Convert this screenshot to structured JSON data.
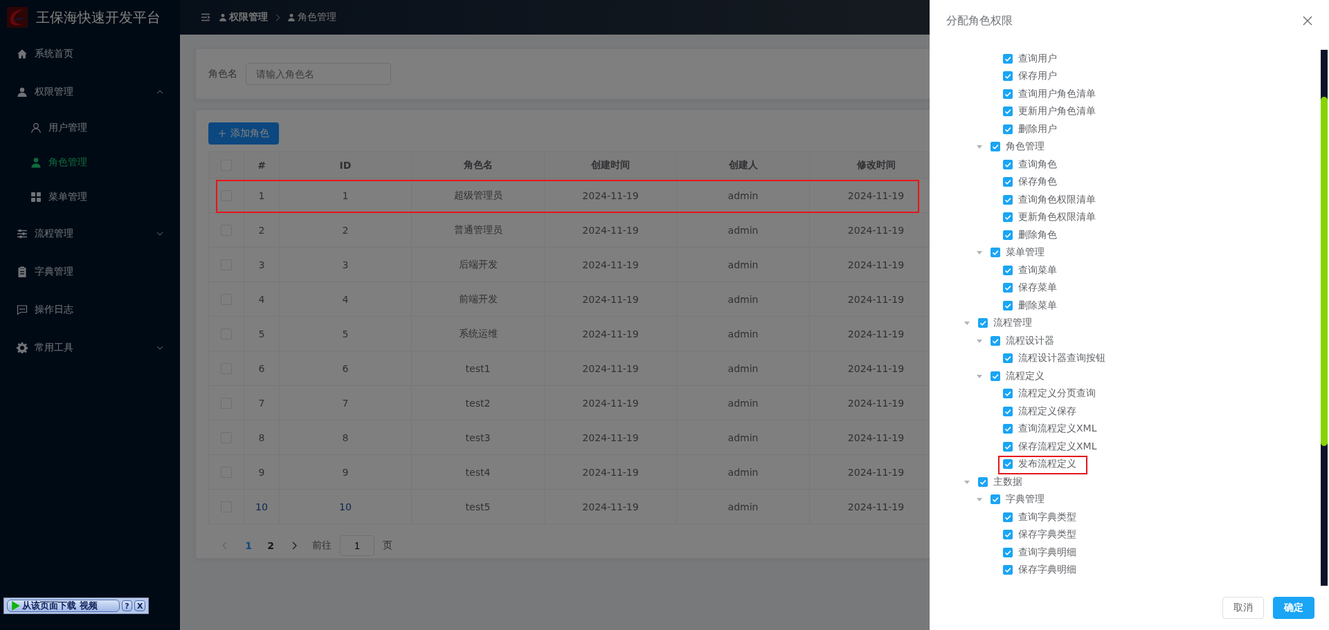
{
  "app": {
    "title": "王保海快速开发平台"
  },
  "breadcrumb": [
    {
      "label": "权限管理"
    },
    {
      "label": "角色管理"
    }
  ],
  "sidebar": {
    "items": [
      {
        "label": "系统首页",
        "selected": false
      },
      {
        "label": "权限管理",
        "selected": false,
        "expanded": true,
        "children": [
          {
            "label": "用户管理",
            "selected": false
          },
          {
            "label": "角色管理",
            "selected": true
          },
          {
            "label": "菜单管理",
            "selected": false
          }
        ]
      },
      {
        "label": "流程管理",
        "selected": false,
        "expanded": false
      },
      {
        "label": "字典管理",
        "selected": false
      },
      {
        "label": "操作日志",
        "selected": false
      },
      {
        "label": "常用工具",
        "selected": false,
        "expanded": false
      }
    ]
  },
  "search": {
    "label": "角色名",
    "placeholder": "请输入角色名"
  },
  "add_button": "添加角色",
  "table": {
    "all_selected": false,
    "columns": [
      "#",
      "ID",
      "角色名",
      "创建时间",
      "创建人",
      "修改时间"
    ],
    "rows": [
      {
        "selected": false,
        "highlighted": true,
        "cells": [
          "1",
          "1",
          "超级管理员",
          "2024-11-19",
          "admin",
          "2024-11-19"
        ]
      },
      {
        "selected": false,
        "highlighted": false,
        "cells": [
          "2",
          "2",
          "普通管理员",
          "2024-11-19",
          "admin",
          "2024-11-19"
        ]
      },
      {
        "selected": false,
        "highlighted": false,
        "cells": [
          "3",
          "3",
          "后端开发",
          "2024-11-19",
          "admin",
          "2024-11-19"
        ]
      },
      {
        "selected": false,
        "highlighted": false,
        "cells": [
          "4",
          "4",
          "前端开发",
          "2024-11-19",
          "admin",
          "2024-11-19"
        ]
      },
      {
        "selected": false,
        "highlighted": false,
        "cells": [
          "5",
          "5",
          "系统运维",
          "2024-11-19",
          "admin",
          "2024-11-19"
        ]
      },
      {
        "selected": false,
        "highlighted": false,
        "cells": [
          "6",
          "6",
          "test1",
          "2024-11-19",
          "admin",
          "2024-11-19"
        ]
      },
      {
        "selected": false,
        "highlighted": false,
        "cells": [
          "7",
          "7",
          "test2",
          "2024-11-19",
          "admin",
          "2024-11-19"
        ]
      },
      {
        "selected": false,
        "highlighted": false,
        "cells": [
          "8",
          "8",
          "test3",
          "2024-11-19",
          "admin",
          "2024-11-19"
        ]
      },
      {
        "selected": false,
        "highlighted": false,
        "cells": [
          "9",
          "9",
          "test4",
          "2024-11-19",
          "admin",
          "2024-11-19"
        ]
      },
      {
        "selected": false,
        "highlighted": false,
        "cells": [
          "10",
          "10",
          "test5",
          "2024-11-19",
          "admin",
          "2024-11-19"
        ]
      }
    ]
  },
  "pagination": {
    "pages": [
      {
        "label": "1",
        "selected": true
      },
      {
        "label": "2",
        "selected": false
      }
    ],
    "goto_label": "前往",
    "goto_value": "1",
    "page_unit": "页"
  },
  "drawer": {
    "title": "分配角色权限",
    "cancel": "取消",
    "confirm": "确定",
    "tree": [
      {
        "children": [
          {
            "children": [
              {
                "label": "查询用户",
                "checked": true,
                "highlighted": false
              },
              {
                "label": "保存用户",
                "checked": true,
                "highlighted": false
              },
              {
                "label": "查询用户角色清单",
                "checked": true,
                "highlighted": false
              },
              {
                "label": "更新用户角色清单",
                "checked": true,
                "highlighted": false
              },
              {
                "label": "删除用户",
                "checked": true,
                "highlighted": false
              }
            ]
          },
          {
            "label": "角色管理",
            "checked": true,
            "expanded": true,
            "highlighted": false,
            "children": [
              {
                "label": "查询角色",
                "checked": true,
                "highlighted": false
              },
              {
                "label": "保存角色",
                "checked": true,
                "highlighted": false
              },
              {
                "label": "查询角色权限清单",
                "checked": true,
                "highlighted": false
              },
              {
                "label": "更新角色权限清单",
                "checked": true,
                "highlighted": false
              },
              {
                "label": "删除角色",
                "checked": true,
                "highlighted": false
              }
            ]
          },
          {
            "label": "菜单管理",
            "checked": true,
            "expanded": true,
            "highlighted": false,
            "children": [
              {
                "label": "查询菜单",
                "checked": true,
                "highlighted": false
              },
              {
                "label": "保存菜单",
                "checked": true,
                "highlighted": false
              },
              {
                "label": "删除菜单",
                "checked": true,
                "highlighted": false
              }
            ]
          }
        ]
      },
      {
        "label": "流程管理",
        "checked": true,
        "expanded": true,
        "highlighted": false,
        "children": [
          {
            "label": "流程设计器",
            "checked": true,
            "expanded": true,
            "highlighted": false,
            "children": [
              {
                "label": "流程设计器查询按钮",
                "checked": true,
                "highlighted": false
              }
            ]
          },
          {
            "label": "流程定义",
            "checked": true,
            "expanded": true,
            "highlighted": false,
            "children": [
              {
                "label": "流程定义分页查询",
                "checked": true,
                "highlighted": false
              },
              {
                "label": "流程定义保存",
                "checked": true,
                "highlighted": false
              },
              {
                "label": "查询流程定义XML",
                "checked": true,
                "highlighted": false
              },
              {
                "label": "保存流程定义XML",
                "checked": true,
                "highlighted": false
              },
              {
                "label": "发布流程定义",
                "checked": true,
                "highlighted": true
              }
            ]
          }
        ]
      },
      {
        "label": "主数据",
        "checked": true,
        "expanded": true,
        "highlighted": false,
        "children": [
          {
            "label": "字典管理",
            "checked": true,
            "expanded": true,
            "highlighted": false,
            "children": [
              {
                "label": "查询字典类型",
                "checked": true,
                "highlighted": false
              },
              {
                "label": "保存字典类型",
                "checked": true,
                "highlighted": false
              },
              {
                "label": "查询字典明细",
                "checked": true,
                "highlighted": false
              },
              {
                "label": "保存字典明细",
                "checked": true,
                "highlighted": false
              }
            ]
          }
        ]
      }
    ]
  },
  "download_bar": {
    "label": "从该页面下载 视频",
    "help": "?",
    "close": "X"
  }
}
